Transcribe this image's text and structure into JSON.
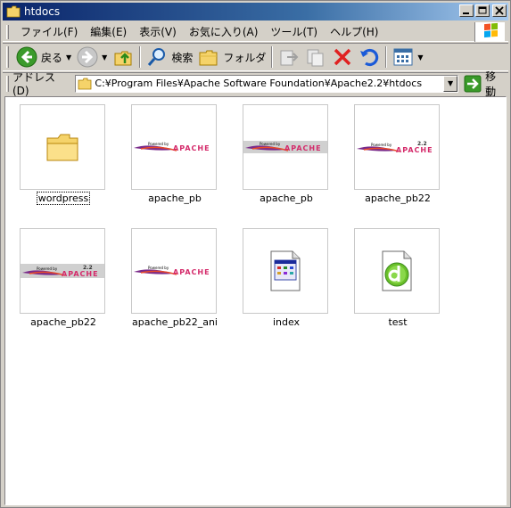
{
  "window": {
    "title": "htdocs"
  },
  "menubar": {
    "items": [
      "ファイル(F)",
      "編集(E)",
      "表示(V)",
      "お気に入り(A)",
      "ツール(T)",
      "ヘルプ(H)"
    ]
  },
  "toolbar": {
    "back_label": "戻る",
    "search_label": "検索",
    "folders_label": "フォルダ"
  },
  "addressbar": {
    "label": "アドレス(D)",
    "path": "C:¥Program Files¥Apache Software Foundation¥Apache2.2¥htdocs",
    "go_label": "移動"
  },
  "files": [
    {
      "name": "wordpress",
      "type": "folder",
      "selected": true
    },
    {
      "name": "apache_pb",
      "type": "apache-logo-white"
    },
    {
      "name": "apache_pb",
      "type": "apache-logo-gray"
    },
    {
      "name": "apache_pb22",
      "type": "apache-logo-22-white"
    },
    {
      "name": "apache_pb22",
      "type": "apache-logo-22-gray"
    },
    {
      "name": "apache_pb22_ani",
      "type": "apache-logo-white"
    },
    {
      "name": "index",
      "type": "html-file-icon"
    },
    {
      "name": "test",
      "type": "dreamweaver-file-icon"
    }
  ],
  "colors": {
    "titlebar_start": "#0a246a",
    "titlebar_end": "#a6caf0",
    "window_bg": "#d4d0c8"
  }
}
